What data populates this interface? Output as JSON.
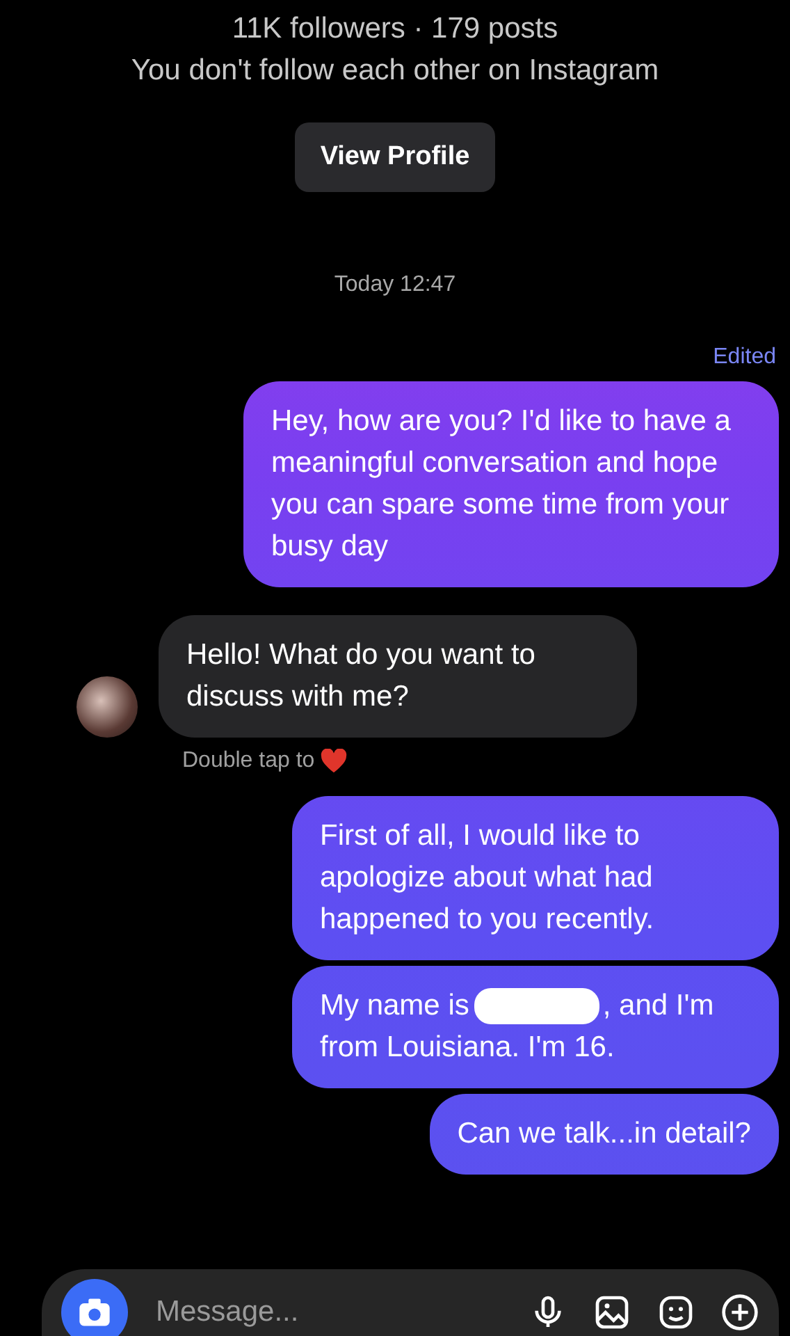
{
  "profile": {
    "stats": "11K followers · 179 posts",
    "relation": "You don't follow each other on Instagram",
    "view_button": "View Profile"
  },
  "timestamp": "Today 12:47",
  "edited_label": "Edited",
  "messages": [
    {
      "kind": "sent",
      "text": "Hey, how are you? I'd like to have a meaningful conversation and hope you can spare some time from your busy day"
    },
    {
      "kind": "received",
      "text": "Hello! What do you want to discuss with me?",
      "hint": "Double tap to"
    },
    {
      "kind": "sent",
      "text": "First of all, I would like to apologize about what had happened to you recently."
    },
    {
      "kind": "redacted",
      "text_before": "My name is",
      "text_after": ", and I'm from Louisiana. I'm 16."
    },
    {
      "kind": "sent",
      "text": "Can we talk...in detail?"
    }
  ],
  "composer": {
    "placeholder": "Message..."
  }
}
